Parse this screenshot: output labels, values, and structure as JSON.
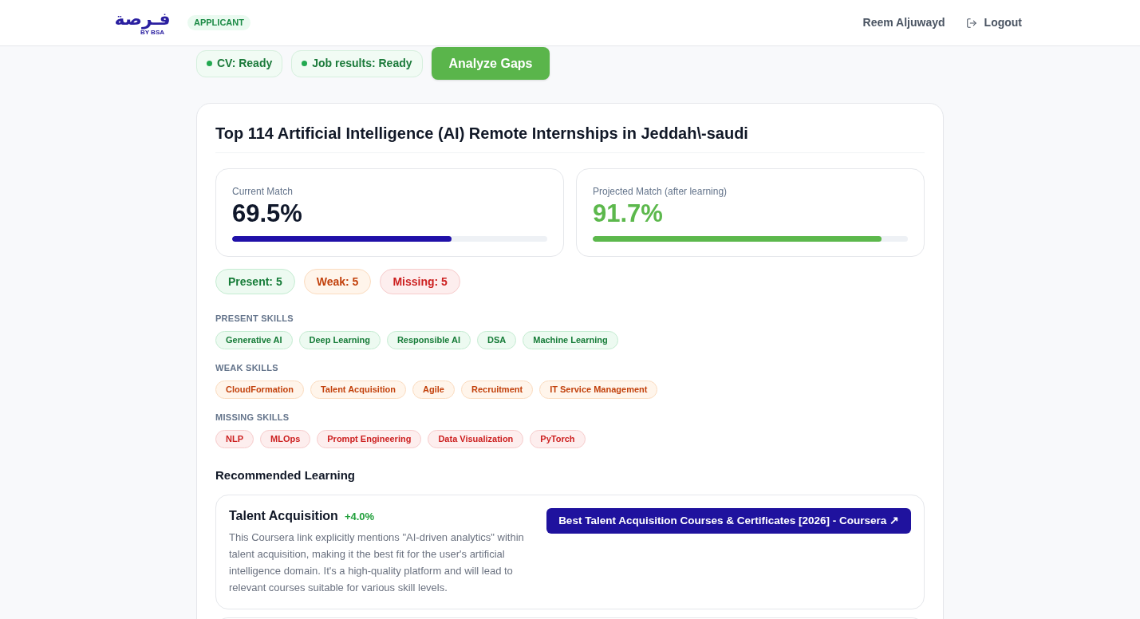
{
  "header": {
    "logo": {
      "wordmark": "فـرصة",
      "byline": "BY BSA"
    },
    "role_badge": "APPLICANT",
    "user_name": "Reem Aljuwayd",
    "logout": "Logout"
  },
  "status_bar": {
    "chips": [
      "CV: Ready",
      "Job results: Ready"
    ],
    "action": "Analyze Gaps"
  },
  "report": {
    "title": "Top 114 Artificial Intelligence (AI) Remote Internships in Jeddah\\-saudi",
    "matches": [
      {
        "kind": "current",
        "label": "Current Match",
        "value": "69.5%",
        "level": 0.695
      },
      {
        "kind": "projected",
        "label": "Projected Match (after learning)",
        "value": "91.7%",
        "level": 0.917
      }
    ],
    "counts": [
      {
        "kind": "present",
        "label": "Present: 5"
      },
      {
        "kind": "weak",
        "label": "Weak: 5"
      },
      {
        "kind": "missing",
        "label": "Missing: 5"
      }
    ],
    "skill_groups": [
      {
        "kind": "present",
        "heading": "PRESENT SKILLS",
        "skills": [
          "Generative AI",
          "Deep Learning",
          "Responsible AI",
          "DSA",
          "Machine Learning"
        ]
      },
      {
        "kind": "weak",
        "heading": "WEAK SKILLS",
        "skills": [
          "CloudFormation",
          "Talent Acquisition",
          "Agile",
          "Recruitment",
          "IT Service Management"
        ]
      },
      {
        "kind": "missing",
        "heading": "MISSING SKILLS",
        "skills": [
          "NLP",
          "MLOps",
          "Prompt Engineering",
          "Data Visualization",
          "PyTorch"
        ]
      }
    ],
    "recommended": {
      "heading": "Recommended Learning",
      "items": [
        {
          "skill": "Talent Acquisition",
          "gain": "+4.0%",
          "reason": "This Coursera link explicitly mentions \"AI-driven analytics\" within talent acquisition, making it the best fit for the user's artificial intelligence domain. It's a high-quality platform and will lead to relevant courses suitable for various skill levels.",
          "link": "Best Talent Acquisition Courses & Certificates [2026] - Coursera ↗"
        }
      ]
    }
  }
}
